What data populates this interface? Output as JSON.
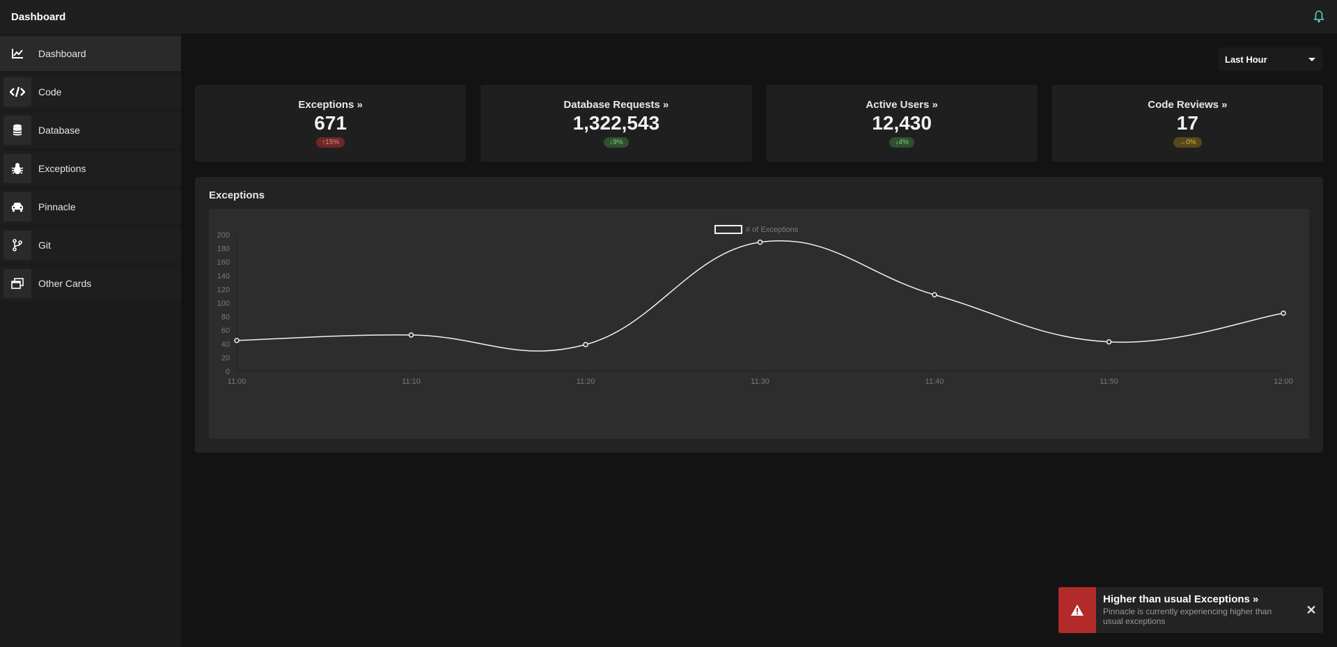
{
  "header": {
    "title": "Dashboard",
    "bell_icon": "bell-icon"
  },
  "sidebar": {
    "items": [
      {
        "label": "Dashboard",
        "icon": "chart-line-icon",
        "active": true
      },
      {
        "label": "Code",
        "icon": "code-icon"
      },
      {
        "label": "Database",
        "icon": "database-icon"
      },
      {
        "label": "Exceptions",
        "icon": "bug-icon"
      },
      {
        "label": "Pinnacle",
        "icon": "car-icon"
      },
      {
        "label": "Git",
        "icon": "git-branch-icon"
      },
      {
        "label": "Other Cards",
        "icon": "window-restore-icon"
      }
    ]
  },
  "range": {
    "selected": "Last Hour"
  },
  "cards": [
    {
      "title": "Exceptions »",
      "value": "671",
      "change": "↑15%",
      "status": "red"
    },
    {
      "title": "Database Requests »",
      "value": "1,322,543",
      "change": "↓9%",
      "status": "green"
    },
    {
      "title": "Active Users »",
      "value": "12,430",
      "change": "↓4%",
      "status": "green"
    },
    {
      "title": "Code Reviews »",
      "value": "17",
      "change": "→0%",
      "status": "yellow"
    }
  ],
  "chart_panel": {
    "title": "Exceptions"
  },
  "chart_data": {
    "type": "line",
    "categories": [
      "11:00",
      "11:10",
      "11:20",
      "11:30",
      "11:40",
      "11:50",
      "12:00"
    ],
    "series": [
      {
        "name": "# of Exceptions",
        "values": [
          45,
          53,
          39,
          189,
          112,
          43,
          85
        ]
      }
    ],
    "yticks": [
      "0",
      "20",
      "40",
      "60",
      "80",
      "100",
      "120",
      "140",
      "160",
      "180",
      "200"
    ],
    "ylim": [
      0,
      200
    ],
    "legend": "top",
    "grid": true,
    "line_color": "#f2f2f2"
  },
  "toast": {
    "title": "Higher than usual Exceptions »",
    "message": "Pinnacle is currently experiencing higher than usual exceptions",
    "icon": "warning-icon",
    "close": "✕"
  }
}
